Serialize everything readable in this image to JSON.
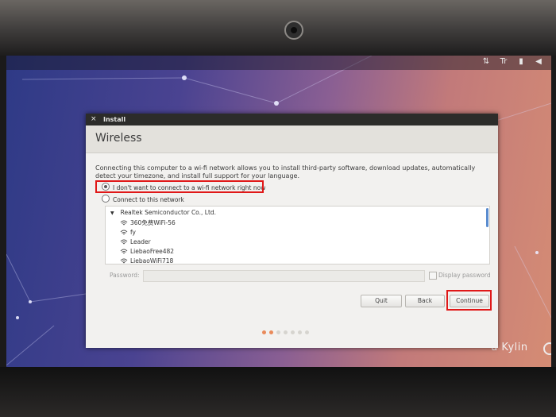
{
  "window": {
    "title": "Install",
    "close_glyph": "×",
    "header": "Wireless",
    "description": "Connecting this computer to a wi-fi network allows you to install third-party software, download updates, automatically detect your timezone, and install full support for your language."
  },
  "options": [
    {
      "label": "I don't want to connect to a wi-fi network right now",
      "selected": true
    },
    {
      "label": "Connect to this network",
      "selected": false
    }
  ],
  "network": {
    "device": "Realtek Semiconductor Co., Ltd.",
    "expand_glyph": "▼",
    "networks": [
      "360免费WiFi-56",
      "fy",
      "Leader",
      "LiebaoFree482",
      "LiebaoWiFi718"
    ]
  },
  "password": {
    "label": "Password:",
    "value": "",
    "display_label": "Display password",
    "display_checked": false
  },
  "buttons": {
    "quit": "Quit",
    "back": "Back",
    "continue": "Continue"
  },
  "progress": {
    "total_steps": 7,
    "current_step": 2
  },
  "desktop": {
    "brand_text": "u Kylin",
    "tray_icons": [
      "network-icon",
      "keyboard-icon",
      "battery-icon",
      "volume-icon"
    ]
  },
  "colors": {
    "highlight": "#e01818",
    "progress_active": "#e98a5a",
    "scroll_accent": "#5a8ccf"
  }
}
